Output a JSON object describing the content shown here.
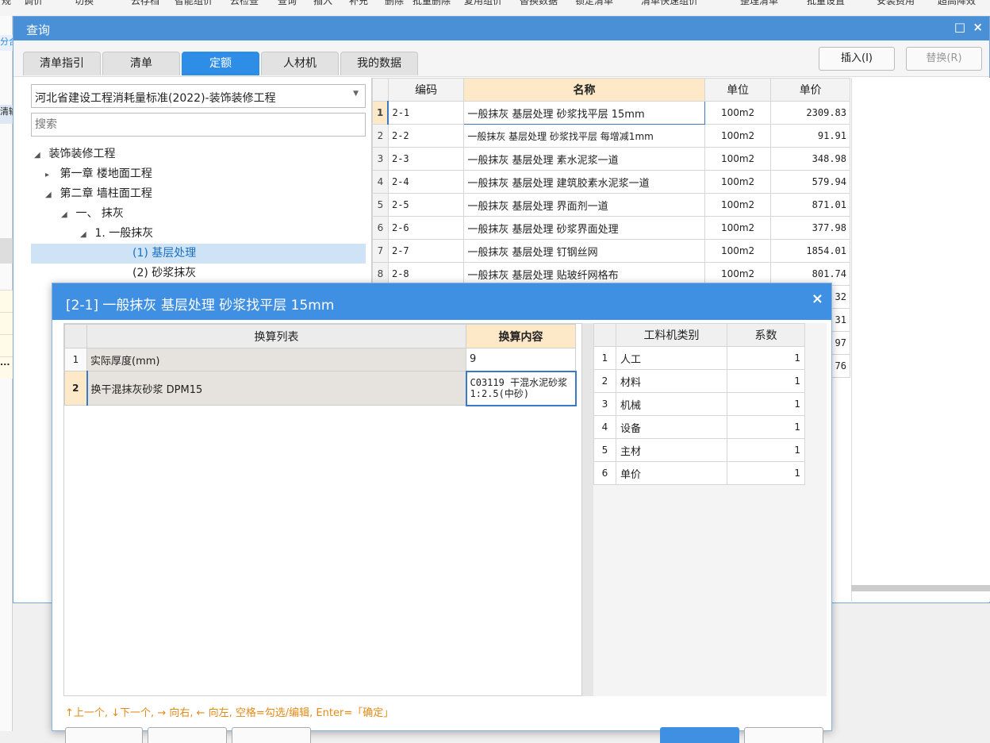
{
  "bg_toolbar": [
    "规",
    "调价",
    "切换",
    "云存档",
    "智能组价",
    "云检查",
    "查询",
    "插入",
    "补充",
    "删除",
    "批量删除",
    "复用组价",
    "替换数据",
    "锁定清单",
    "清单快速组价",
    "整理清单",
    "批量设置",
    "安装费用",
    "超高降效"
  ],
  "bg_left": [
    "分合",
    "清输",
    "..."
  ],
  "query_window": {
    "title": "查询",
    "controls": [
      "□",
      "×"
    ],
    "tabs": [
      "清单指引",
      "清单",
      "定额",
      "人材机",
      "我的数据"
    ],
    "insert_button": "插入(I)",
    "replace_button": "替换(R)",
    "library": "河北省建设工程消耗量标准(2022)-装饰装修工程",
    "search_placeholder": "搜索",
    "tree": [
      {
        "arrow": "◢",
        "label": "装饰装修工程"
      },
      {
        "arrow": "▸",
        "label": "第一章 楼地面工程"
      },
      {
        "arrow": "◢",
        "label": "第二章 墙柱面工程"
      },
      {
        "arrow": "◢",
        "label": "一、 抹灰"
      },
      {
        "arrow": "◢",
        "label": "1. 一般抹灰"
      },
      {
        "arrow": "",
        "label": "(1) 基层处理"
      },
      {
        "arrow": "",
        "label": "(2) 砂浆抹灰"
      }
    ],
    "grid": {
      "headers": [
        "",
        "编码",
        "名称",
        "单位",
        "单价"
      ],
      "rows": [
        {
          "idx": "1",
          "code": "2-1",
          "name": "一般抹灰 基层处理 砂浆找平层 15mm",
          "unit": "100m2",
          "price": "2309.83"
        },
        {
          "idx": "2",
          "code": "2-2",
          "name": "一般抹灰 基层处理 砂浆找平层 每增减1mm",
          "unit": "100m2",
          "price": "91.91"
        },
        {
          "idx": "3",
          "code": "2-3",
          "name": "一般抹灰 基层处理 素水泥浆一道",
          "unit": "100m2",
          "price": "348.98"
        },
        {
          "idx": "4",
          "code": "2-4",
          "name": "一般抹灰 基层处理 建筑胶素水泥浆一道",
          "unit": "100m2",
          "price": "579.94"
        },
        {
          "idx": "5",
          "code": "2-5",
          "name": "一般抹灰 基层处理 界面剂一道",
          "unit": "100m2",
          "price": "871.01"
        },
        {
          "idx": "6",
          "code": "2-6",
          "name": "一般抹灰 基层处理 砂浆界面处理",
          "unit": "100m2",
          "price": "377.98"
        },
        {
          "idx": "7",
          "code": "2-7",
          "name": "一般抹灰 基层处理 钉钢丝网",
          "unit": "100m2",
          "price": "1854.01"
        },
        {
          "idx": "8",
          "code": "2-8",
          "name": "一般抹灰 基层处理 贴玻纤网格布",
          "unit": "100m2",
          "price": "801.74"
        }
      ],
      "hidden_price_tails": [
        "32",
        "31",
        "97",
        "76"
      ]
    }
  },
  "dialog": {
    "title": "[2-1] 一般抹灰 基层处理 砂浆找平层 15mm",
    "close": "×",
    "conv_headers": [
      "",
      "换算列表",
      "换算内容"
    ],
    "conv_rows": [
      {
        "idx": "1",
        "name": "实际厚度(mm)",
        "value": "9"
      },
      {
        "idx": "2",
        "name": "换干混抹灰砂浆 DPM15",
        "value": "C03119  干混水泥砂浆 1:2.5(中砂)"
      }
    ],
    "cat_headers": [
      "",
      "工料机类别",
      "系数"
    ],
    "cat_rows": [
      {
        "idx": "1",
        "name": "人工",
        "coef": "1"
      },
      {
        "idx": "2",
        "name": "材料",
        "coef": "1"
      },
      {
        "idx": "3",
        "name": "机械",
        "coef": "1"
      },
      {
        "idx": "4",
        "name": "设备",
        "coef": "1"
      },
      {
        "idx": "5",
        "name": "主材",
        "coef": "1"
      },
      {
        "idx": "6",
        "name": "单价",
        "coef": "1"
      }
    ],
    "hint": "↑上一个, ↓下一个, → 向右, ← 向左, 空格=勾选/编辑, Enter=「确定」"
  }
}
